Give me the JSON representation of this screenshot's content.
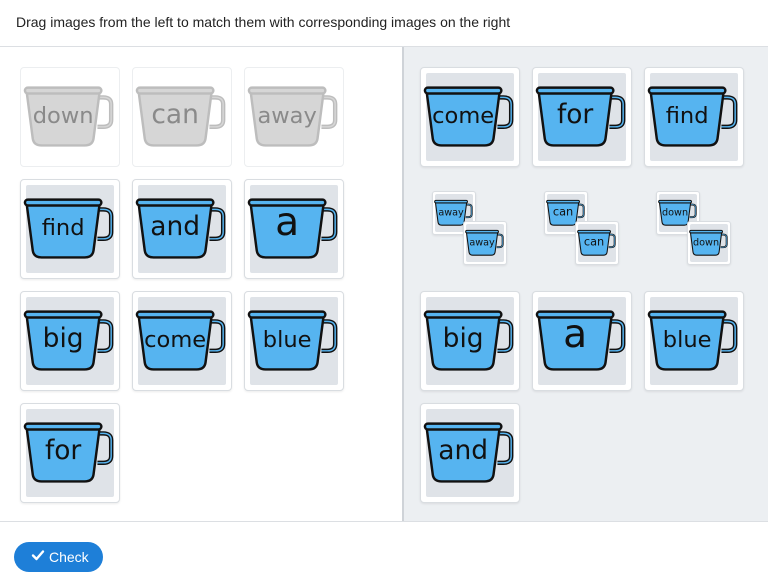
{
  "instruction": "Drag images from the left to match them with corresponding images on the right",
  "check_label": "Check",
  "colors": {
    "mug_fill": "#56b4f0",
    "ghost_fill": "#d4d4d4",
    "accent": "#1e7fd8"
  },
  "source_cards": [
    {
      "word": "down",
      "placed": true
    },
    {
      "word": "can",
      "placed": true
    },
    {
      "word": "away",
      "placed": true
    },
    {
      "word": "find",
      "placed": false
    },
    {
      "word": "and",
      "placed": false
    },
    {
      "word": "a",
      "placed": false
    },
    {
      "word": "big",
      "placed": false
    },
    {
      "word": "come",
      "placed": false
    },
    {
      "word": "blue",
      "placed": false
    },
    {
      "word": "for",
      "placed": false
    }
  ],
  "target_cards": [
    {
      "word": "come"
    },
    {
      "word": "for"
    },
    {
      "word": "find"
    },
    {
      "word": "big"
    },
    {
      "word": "a"
    },
    {
      "word": "blue"
    },
    {
      "word": "and"
    }
  ],
  "matched_pairs": [
    {
      "dragged": "away",
      "target": "away"
    },
    {
      "dragged": "can",
      "target": "can"
    },
    {
      "dragged": "down",
      "target": "down"
    }
  ]
}
